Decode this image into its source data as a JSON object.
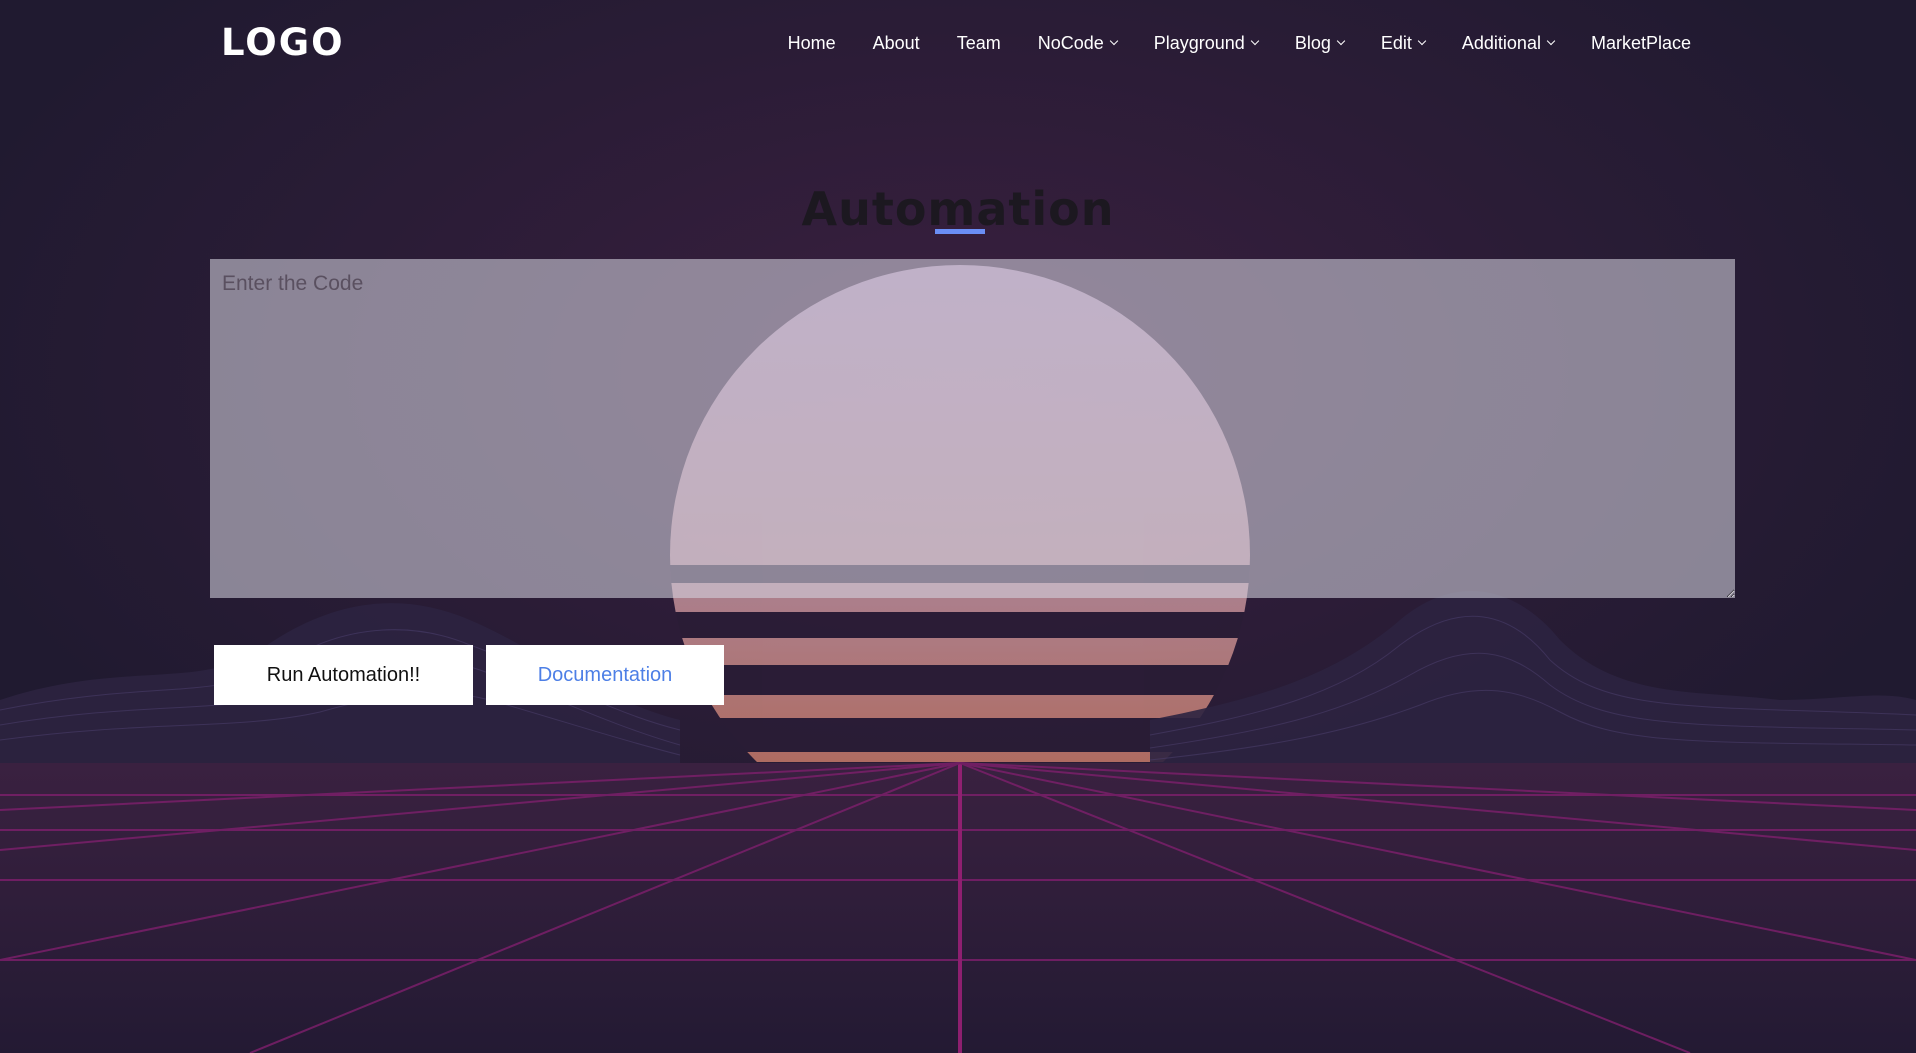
{
  "navbar": {
    "logo": "LOGO",
    "items": [
      {
        "label": "Home",
        "dropdown": false
      },
      {
        "label": "About",
        "dropdown": false
      },
      {
        "label": "Team",
        "dropdown": false
      },
      {
        "label": "NoCode",
        "dropdown": true
      },
      {
        "label": "Playground",
        "dropdown": true
      },
      {
        "label": "Blog",
        "dropdown": true
      },
      {
        "label": "Edit",
        "dropdown": true
      },
      {
        "label": "Additional",
        "dropdown": true
      },
      {
        "label": "MarketPlace",
        "dropdown": false
      }
    ]
  },
  "main": {
    "title": "Automation",
    "code_input": {
      "value": "",
      "placeholder": "Enter the Code"
    },
    "buttons": {
      "run_label": "Run Automation!!",
      "docs_label": "Documentation"
    }
  },
  "colors": {
    "background": "#221a33",
    "accent": "#6a8ef5",
    "link_blue": "#4d7fe6",
    "grid_magenta": "#a0207a",
    "sun_top": "#c9a6cf",
    "sun_bottom": "#e07850"
  },
  "icons": {
    "dropdown": "chevron-down-icon"
  }
}
